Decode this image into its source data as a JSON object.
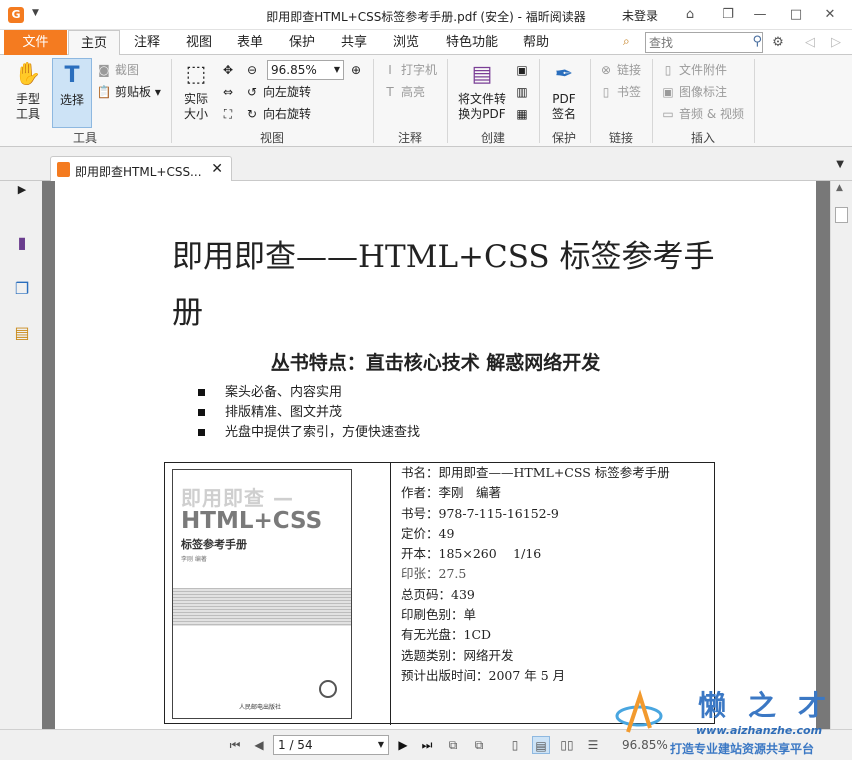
{
  "window": {
    "title": "即用即查HTML+CSS标签参考手册.pdf (安全) - 福昕阅读器",
    "login": "未登录"
  },
  "menu": {
    "file": "文件",
    "items": [
      "主页",
      "注释",
      "视图",
      "表单",
      "保护",
      "共享",
      "浏览",
      "特色功能",
      "帮助"
    ],
    "active": "主页"
  },
  "search": {
    "placeholder": "查找"
  },
  "ribbon": {
    "tools": {
      "label": "工具",
      "hand": "手型\n工具",
      "select": "选择",
      "screenshot": "截图",
      "clipboard": "剪贴板"
    },
    "view": {
      "label": "视图",
      "actual": "实际\n大小",
      "zoom": "96.85%",
      "rotate_left": "向左旋转",
      "rotate_right": "向右旋转"
    },
    "annotate": {
      "label": "注释",
      "typewriter": "打字机",
      "highlight": "高亮"
    },
    "create": {
      "label": "创建",
      "convert": "将文件转\n换为PDF"
    },
    "protect": {
      "label": "保护",
      "sign": "PDF\n签名"
    },
    "links": {
      "label": "链接",
      "link": "链接",
      "bookmark": "书签"
    },
    "insert": {
      "label": "插入",
      "attachment": "文件附件",
      "image": "图像标注",
      "media": "音频 & 视频"
    }
  },
  "tab": {
    "title": "即用即查HTML+CSS..."
  },
  "document": {
    "title": "即用即查——HTML+CSS 标签参考手册",
    "subtitle": "丛书特点：直击核心技术 解惑网络开发",
    "bullets": [
      "案头必备、内容实用",
      "排版精准、图文并茂",
      "光盘中提供了索引，方便快速查找"
    ],
    "cover": {
      "line1": "即用即查 —",
      "line2": "HTML+CSS",
      "line3": "标签参考手册",
      "author": "李刚 编著",
      "publisher": "人民邮电出版社"
    },
    "details": [
      "书名：即用即查——HTML+CSS 标签参考手册",
      "作者：李刚　编著",
      "书号：978-7-115-16152-9",
      "定价：49",
      "开本：185×260　 1/16",
      "印张：27.5",
      "总页码：439",
      "印刷色别：单",
      "有无光盘：1CD",
      "选题类别：网络开发",
      "预计出版时间：2007 年 5 月"
    ]
  },
  "status": {
    "page": "1 / 54",
    "zoom": "96.85%"
  },
  "watermark": {
    "cn": "懒之才",
    "url": "www.aizhanzhe.com",
    "tagline": "打造专业建站资源共享平台"
  },
  "colors": {
    "accent": "#f47b20",
    "docbg": "#787878",
    "selected": "#cde3f6"
  }
}
